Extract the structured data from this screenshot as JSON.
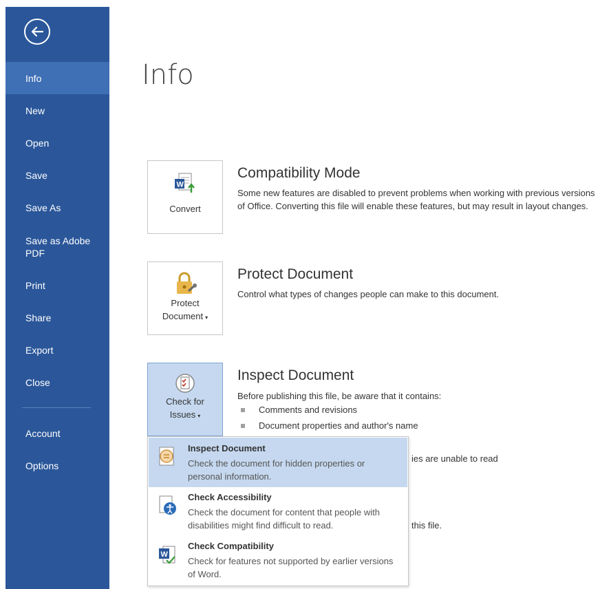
{
  "sidebar": {
    "items": [
      {
        "label": "Info"
      },
      {
        "label": "New"
      },
      {
        "label": "Open"
      },
      {
        "label": "Save"
      },
      {
        "label": "Save As"
      },
      {
        "label": "Save as Adobe PDF"
      },
      {
        "label": "Print"
      },
      {
        "label": "Share"
      },
      {
        "label": "Export"
      },
      {
        "label": "Close"
      },
      {
        "label": "Account"
      },
      {
        "label": "Options"
      }
    ],
    "active": "Info"
  },
  "page": {
    "title": "Info"
  },
  "sections": {
    "compat": {
      "button_label": "Convert",
      "title": "Compatibility Mode",
      "description": "Some new features are disabled to prevent problems when working with previous versions of Office. Converting this file will enable these features, but may result in layout changes."
    },
    "protect": {
      "button_line1": "Protect",
      "button_line2": "Document",
      "title": "Protect Document",
      "description": "Control what types of changes people can make to this document."
    },
    "inspect": {
      "button_line1": "Check for",
      "button_line2": "Issues",
      "title": "Inspect Document",
      "description": "Before publishing this file, be aware that it contains:",
      "bullets": [
        "Comments and revisions",
        "Document properties and author's name"
      ],
      "partial_line1": "ies are unable to read",
      "partial_line2": "this file."
    }
  },
  "dropdown": {
    "items": [
      {
        "title": "Inspect Document",
        "description": "Check the document for hidden properties or personal information."
      },
      {
        "title": "Check Accessibility",
        "description": "Check the document for content that people with disabilities might find difficult to read."
      },
      {
        "title": "Check Compatibility",
        "description": "Check for features not supported by earlier versions of Word."
      }
    ]
  },
  "colors": {
    "sidebar_bg": "#2b579a",
    "sidebar_active": "#3f6fb5",
    "highlight": "#c5d8ef"
  }
}
